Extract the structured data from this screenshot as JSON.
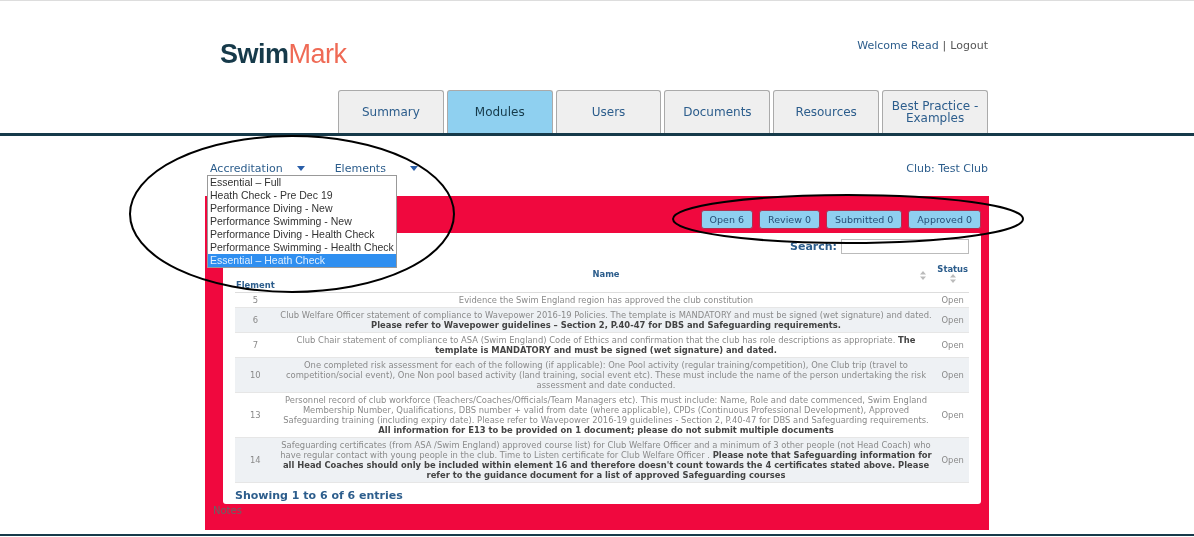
{
  "header": {
    "logo": {
      "first": "Swim",
      "second": "Mark"
    },
    "welcome": "Welcome Read",
    "separator": "|",
    "logout": "Logout"
  },
  "tabs": [
    {
      "label": "Summary",
      "selected": false
    },
    {
      "label": "Modules",
      "selected": true
    },
    {
      "label": "Users",
      "selected": false
    },
    {
      "label": "Documents",
      "selected": false
    },
    {
      "label": "Resources",
      "selected": false
    },
    {
      "label": "Best Practice - Examples",
      "selected": false
    }
  ],
  "filters": {
    "accreditation": {
      "label": "Accreditation",
      "expanded": true,
      "options": [
        {
          "label": "Essential – Full",
          "selected": false
        },
        {
          "label": "Heath Check - Pre Dec 19",
          "selected": false
        },
        {
          "label": "Performance Diving - New",
          "selected": false
        },
        {
          "label": "Performance Swimming - New",
          "selected": false
        },
        {
          "label": "Performance Diving - Health Check",
          "selected": false
        },
        {
          "label": "Performance Swimming - Health Check",
          "selected": false
        },
        {
          "label": "Essential – Heath Check",
          "selected": true
        }
      ]
    },
    "elements": {
      "label": "Elements"
    },
    "club": "Club: Test Club"
  },
  "status_buttons": [
    "Open 6",
    "Review 0",
    "Submitted 0",
    "Approved 0"
  ],
  "search": {
    "label": "Search:"
  },
  "table": {
    "columns": [
      "Element",
      "Name",
      "Status"
    ],
    "rows": [
      {
        "element": "5",
        "name": "Evidence the Swim England region has approved the club constitution",
        "status": "Open"
      },
      {
        "element": "6",
        "name": "Club Welfare Officer statement of compliance to Wavepower 2016-19 Policies. The template is MANDATORY and must be signed (wet signature) and dated. **Please refer to Wavepower guidelines – Section 2, P.40-47 for DBS and Safeguarding requirements.**",
        "status": "Open"
      },
      {
        "element": "7",
        "name": "Club Chair statement of compliance to ASA (Swim England) Code of Ethics and confirmation that the club has role descriptions as appropriate. **The template is MANDATORY and must be signed (wet signature) and dated.**",
        "status": "Open"
      },
      {
        "element": "10",
        "name": "One completed risk assessment for each of the following (if applicable): One Pool activity (regular training/competition), One Club trip (travel to competition/social event), One Non pool based activity (land training, social event etc). These must include the name of the person undertaking the risk assessment and date conducted.",
        "status": "Open"
      },
      {
        "element": "13",
        "name": "Personnel record of club workforce (Teachers/Coaches/Officials/Team Managers etc). This must include: Name, Role and date commenced, Swim England Membership Number, Qualifications, DBS number + valid from date (where applicable), CPDs (Continuous Professional Development), Approved Safeguarding training (including expiry date). Please refer to Wavepower 2016-19 guidelines - Section 2, P.40-47 for DBS and Safeguarding requirements. **All information for E13 to be provided on 1 document; please do not submit multiple documents**",
        "status": "Open"
      },
      {
        "element": "14",
        "name": "Safeguarding certificates (from ASA /Swim England) approved course list) for Club Welfare Officer and a minimum of 3 other people (not Head Coach) who have regular contact with young people in the club. Time to Listen certificate for Club Welfare Officer . **Please note that Safeguarding information for all Head Coaches should only be included within element 16 and therefore doesn't count towards the 4 certificates stated above. Please refer to the guidance document for a list of approved Safeguarding courses**",
        "status": "Open"
      }
    ]
  },
  "footer": "Showing 1 to 6 of 6 entries",
  "notes": "Notes"
}
